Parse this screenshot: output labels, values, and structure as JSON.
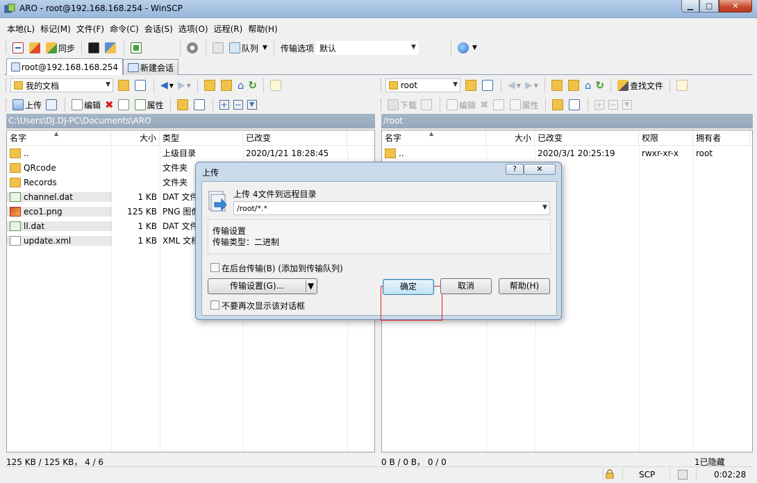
{
  "window": {
    "title": "ARO - root@192.168.168.254 - WinSCP"
  },
  "menu": [
    "本地(L)",
    "标记(M)",
    "文件(F)",
    "命令(C)",
    "会话(S)",
    "选项(O)",
    "远程(R)",
    "帮助(H)"
  ],
  "toolbar": {
    "sync_label": "同步",
    "queue_label": "队列",
    "transfer_options_label": "传输选项",
    "transfer_options_value": "默认"
  },
  "tabs": [
    {
      "label": "root@192.168.168.254"
    },
    {
      "label": "新建会话"
    }
  ],
  "left_panel": {
    "location_combo": "我的文档",
    "upload_label": "上传",
    "edit_label": "编辑",
    "properties_label": "属性",
    "path": "C:\\Users\\DJ.DJ-PC\\Documents\\ARO",
    "columns": [
      "名字",
      "大小",
      "类型",
      "已改变"
    ],
    "rows": [
      {
        "name": "..",
        "size": "",
        "type": "上级目录",
        "changed": "2020/1/21  18:28:45",
        "icon": "folder-up-icon"
      },
      {
        "name": "QRcode",
        "size": "",
        "type": "文件夹",
        "changed": "",
        "icon": "folder-icon"
      },
      {
        "name": "Records",
        "size": "",
        "type": "文件夹",
        "changed": "",
        "icon": "folder-icon"
      },
      {
        "name": "channel.dat",
        "size": "1 KB",
        "type": "DAT 文件",
        "changed": "",
        "icon": "dat-file-icon"
      },
      {
        "name": "eco1.png",
        "size": "125 KB",
        "type": "PNG 图像",
        "changed": "",
        "icon": "png-file-icon"
      },
      {
        "name": "ll.dat",
        "size": "1 KB",
        "type": "DAT 文件",
        "changed": "",
        "icon": "dat-file-icon"
      },
      {
        "name": "update.xml",
        "size": "1 KB",
        "type": "XML 文档",
        "changed": "",
        "icon": "xml-file-icon"
      }
    ],
    "status": "125 KB / 125 KB， 4 / 6"
  },
  "right_panel": {
    "location_combo": "root",
    "download_label": "下载",
    "edit_label": "编辑",
    "properties_label": "属性",
    "find_files_label": "查找文件",
    "path": "/root",
    "columns": [
      "名字",
      "大小",
      "已改变",
      "权限",
      "拥有者"
    ],
    "rows": [
      {
        "name": "..",
        "size": "",
        "changed": "2020/3/1 20:25:19",
        "rights": "rwxr-xr-x",
        "owner": "root"
      }
    ],
    "status": "0 B / 0 B， 0 / 0",
    "hidden": "1已隐藏"
  },
  "statusbar": {
    "protocol": "SCP",
    "elapsed": "0:02:28"
  },
  "dialog": {
    "title": "上传",
    "help_glyph": "?",
    "close_glyph": "✕",
    "heading": "上传 4文件到远程目录",
    "target_value": "/root/*.*",
    "settings_title": "传输设置",
    "settings_detail": "传输类型：二进制",
    "background_label": "在后台传输(B) (添加到传输队列)",
    "transfer_settings_button": "传输设置(G)...",
    "dont_show_label": "不要再次显示该对话框",
    "ok_button": "确定",
    "cancel_button": "取消",
    "help_button": "帮助(H)",
    "highlight_color": "#e02020"
  }
}
